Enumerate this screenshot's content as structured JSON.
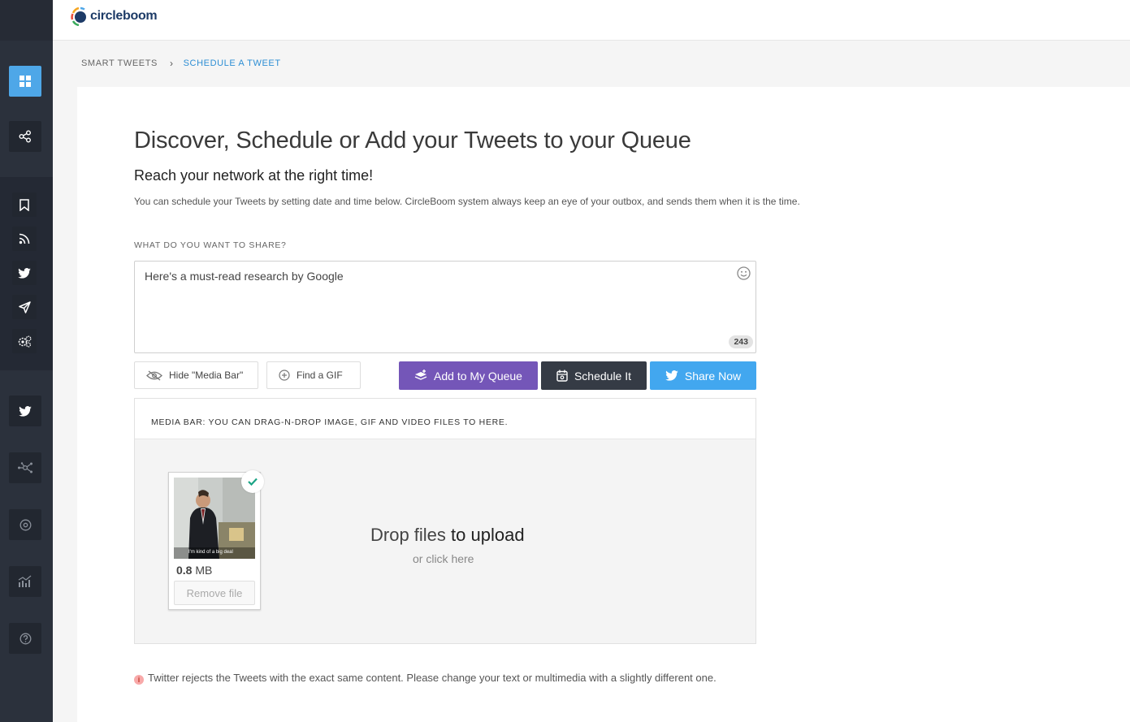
{
  "app": {
    "logo_text": "circleboom"
  },
  "breadcrumb": {
    "parent": "SMART TWEETS",
    "current": "SCHEDULE A TWEET"
  },
  "page": {
    "title": "Discover, Schedule or Add your Tweets to your Queue",
    "subtitle": "Reach your network at the right time!",
    "description": "You can schedule your Tweets by setting date and time below. CircleBoom system always keep an eye of your outbox, and sends them when it is the time.",
    "share_label": "WHAT DO YOU WANT TO SHARE?"
  },
  "composer": {
    "value": "Here's a must-read research by Google",
    "char_counter": "243"
  },
  "toolbar": {
    "hide_media_bar": "Hide \"Media Bar\"",
    "find_gif": "Find a GIF"
  },
  "actions": {
    "add_queue": "Add to My Queue",
    "schedule": "Schedule It",
    "share_now": "Share Now"
  },
  "media_bar": {
    "header": "MEDIA BAR: YOU CAN DRAG-N-DROP IMAGE, GIF AND VIDEO FILES TO HERE.",
    "file": {
      "size_value": "0.8",
      "size_unit": "MB",
      "remove_label": "Remove file",
      "caption": "I'm kind of a big deal"
    },
    "drop_text_a": "Drop files",
    "drop_text_b": "to upload",
    "drop_sub": "or click here"
  },
  "warning": "Twitter rejects the Tweets with the exact same content. Please change your text or multimedia with a slightly different one.",
  "colors": {
    "accent_blue": "#4ea7e8",
    "queue_purple": "#7456b8",
    "schedule_dark": "#353b45",
    "twitter_blue": "#42a7ef",
    "sidebar_bg": "#2b313c"
  },
  "sidebar_icons": [
    "dashboard-icon",
    "share-icon",
    "bookmark-icon",
    "rss-icon",
    "twitter-icon",
    "send-icon",
    "settings-icon",
    "twitter-icon",
    "network-icon",
    "circle-icon",
    "chart-icon",
    "help-icon"
  ]
}
